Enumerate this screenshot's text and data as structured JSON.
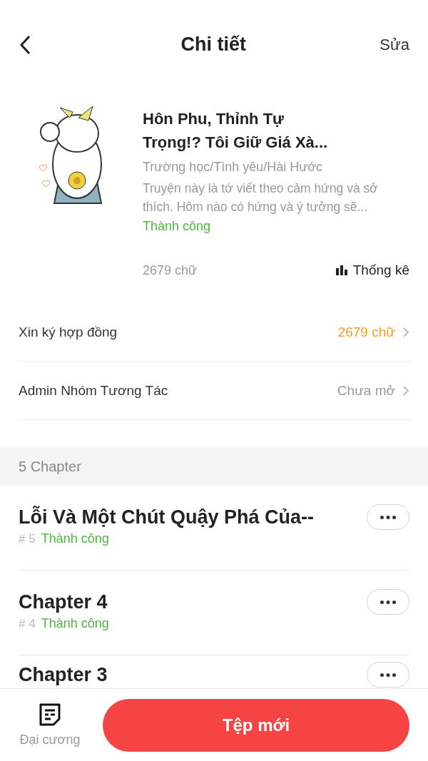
{
  "header": {
    "title": "Chi tiết",
    "action": "Sửa"
  },
  "book": {
    "title": "Hôn Phu, Thỉnh Tự Trọng!? Tôi Giữ Giá Xà...",
    "genres": "Trường học/Tình yêu/Hài Hước",
    "description": "Truyện này là tớ viết theo cảm hứng và sở thích. Hôm nào có hứng và ý tưởng sẽ...",
    "status": "Thành công",
    "word_count": "2679 chữ",
    "stats_label": "Thống kê"
  },
  "settings": [
    {
      "label": "Xin ký hợp đồng",
      "value": "2679 chữ",
      "kind": "accent"
    },
    {
      "label": "Admin Nhóm Tương Tác",
      "value": "Chưa mở",
      "kind": "muted"
    }
  ],
  "chapter_section": {
    "title": "5 Chapter"
  },
  "chapters": [
    {
      "title": "Lỗi Và Một Chút Quậy Phá Của--",
      "number": "# 5",
      "status": "Thành công"
    },
    {
      "title": "Chapter 4",
      "number": "# 4",
      "status": "Thành công"
    },
    {
      "title": "Chapter 3"
    }
  ],
  "bottom_bar": {
    "outline_label": "Đại cương",
    "new_button": "Tệp mới"
  }
}
